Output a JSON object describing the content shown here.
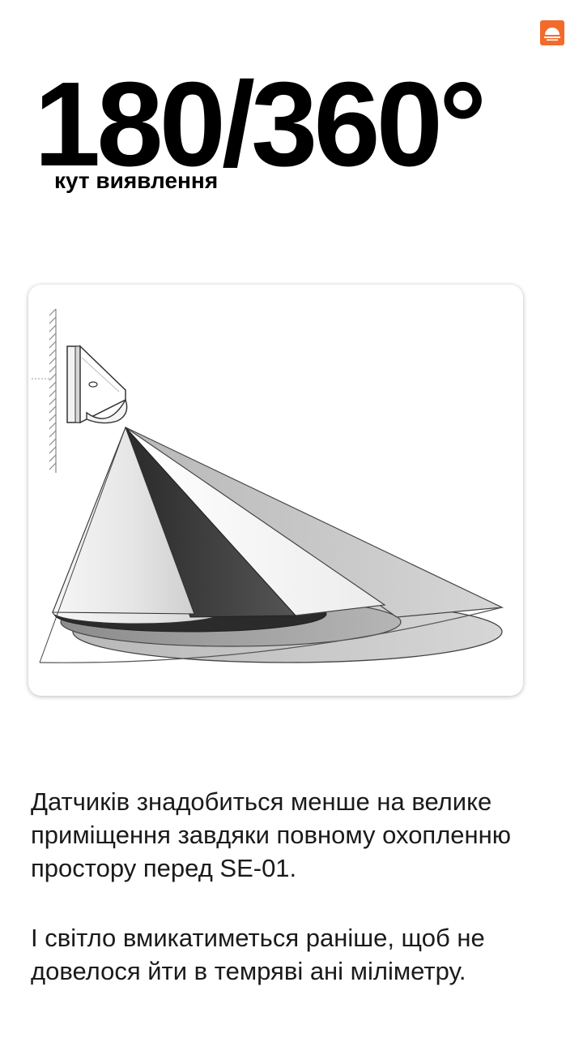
{
  "brand": {
    "logo_icon": "sunrise-icon",
    "accent_color": "#f26b2a"
  },
  "hero": {
    "number": "180/360°",
    "caption": "кут виявлення"
  },
  "illustration": {
    "icon": "motion-sensor-detection-zones-icon"
  },
  "body": {
    "paragraph_1": "Датчиків знадобиться менше на велике приміщення завдяки повному охопленню простору перед SE-01.",
    "paragraph_2": "І світло вмикатиметься раніше, щоб не довелося йти в темряві ані міліметру."
  }
}
